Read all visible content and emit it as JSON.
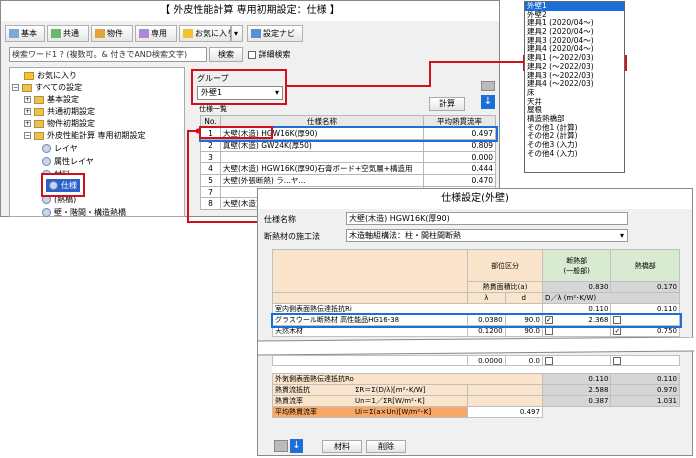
{
  "window": {
    "title": "【 外皮性能計算 専用初期設定：仕様 】",
    "toolbar": [
      "基本",
      "共通",
      "物件",
      "専用",
      "お気に入り",
      "設定ナビ"
    ],
    "search_value": "検索ワード1 ? (複数可。& 付きでAND検索文字)",
    "search_button": "検索",
    "detail_search": "詳細検索"
  },
  "tree": {
    "favorites": "お気に入り",
    "all_settings": "すべての設定",
    "basic": "基本設定",
    "common": "共通初期設定",
    "property": "物件初期設定",
    "envelope": "外皮性能計算 専用初期設定",
    "layer": "レイヤ",
    "attr_layer": "属性レイヤ",
    "material": "材料",
    "spec": "仕様",
    "hidden_item": "(熱橋)",
    "wall_bridge": "壁・階間・構造熱橋"
  },
  "group": {
    "label": "グループ",
    "value": "外壁1",
    "calc_button": "計算",
    "list_caption": "仕様一覧"
  },
  "spec_list": {
    "headers": [
      "No.",
      "仕様名称",
      "平均熱貫流率"
    ],
    "rows": [
      {
        "no": "1",
        "name": "大壁(木造) HGW16K(厚90)",
        "value": "0.497"
      },
      {
        "no": "2",
        "name": "真壁(木造) GW24K(厚50)",
        "value": "0.809"
      },
      {
        "no": "3",
        "name": "",
        "value": "0.000"
      },
      {
        "no": "4",
        "name": "大壁(木造) HGW16K(厚90)石膏ボード+空気層+構造用",
        "value": "0.444"
      },
      {
        "no": "5",
        "name": "大壁(外張断熱) ラ...ヤ...",
        "value": "0.470"
      },
      {
        "no": "7",
        "name": "",
        "value": ""
      },
      {
        "no": "8",
        "name": "大壁(木造)",
        "value": ""
      }
    ]
  },
  "dropdown_options": [
    "外壁1",
    "外壁2",
    "建具1 (2020/04～)",
    "建具2 (2020/04～)",
    "建具3 (2020/04～)",
    "建具4 (2020/04～)",
    "建具1 (～2022/03)",
    "建具2 (～2022/03)",
    "建具3 (～2022/03)",
    "建具4 (～2022/03)",
    "床",
    "天井",
    "屋根",
    "構造熱橋部",
    "その他1 (計算)",
    "その他2 (計算)",
    "その他3 (入力)",
    "その他4 (入力)"
  ],
  "spec_dialog": {
    "title": "仕様設定(外壁)",
    "name_label": "仕様名称",
    "name_value": "大壁(木造) HGW16K(厚90)",
    "method_label": "断熱材の施工法",
    "method_value": "木造軸組構法：柱・間柱間断熱",
    "col_section": "部位区分",
    "col_insulation": "断熱部\n(一般部)",
    "col_bridge": "熱橋部",
    "area_ratio_label": "熱貫面積比(a)",
    "lambda": "λ",
    "d": "d",
    "dl_unit": "D／λ (m²･K/W)",
    "area_ins": "0.830",
    "area_bridge": "0.170",
    "ri_label": "室内側表面熱伝達抵抗Ri",
    "ri_ins": "0.110",
    "ri_bridge": "0.110",
    "rows": [
      {
        "name": "グラスウール断熱材 高性能品HG16-38",
        "lambda": "0.0380",
        "d": "90.0",
        "ins": "2.368",
        "bridge": ""
      },
      {
        "name": "天然木材",
        "lambda": "0.1200",
        "d": "90.0",
        "ins": "",
        "bridge": "0.750"
      },
      {
        "name": "",
        "lambda": "0.0000",
        "d": "0.0",
        "ins": "",
        "bridge": ""
      }
    ],
    "ro_label": "外気側表面熱伝達抵抗Ro",
    "ro_ins": "0.110",
    "ro_bridge": "0.110",
    "resist_label": "熱貫流抵抗",
    "resist_formula": "ΣR＝Σ(D/λ)[m²･K/W]",
    "resist_ins": "2.588",
    "resist_bridge": "0.970",
    "u_label": "熱貫流率",
    "u_formula": "Un＝1／ΣR[W/m²･K]",
    "u_ins": "0.387",
    "u_bridge": "1.031",
    "avg_label": "平均熱貫流率",
    "avg_formula": "Ui＝Σ(a×Un)[W/m²･K]",
    "avg_value": "0.497",
    "material_button": "材料",
    "delete_button": "削除"
  },
  "colors": {
    "highlight": "#d0101c",
    "accent_blue": "#1b6fd6",
    "header_orange": "#fbe4cc",
    "avg_orange": "#f8a764"
  }
}
